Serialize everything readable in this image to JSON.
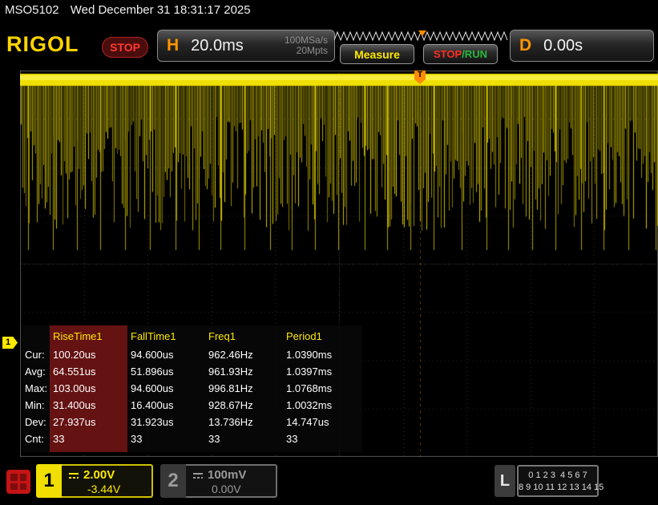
{
  "colors": {
    "ch1_yellow": "#ffe900",
    "accent_orange": "#ff9500",
    "stop_red": "#ff3b30",
    "run_green": "#27b83c",
    "logo_yellow": "#ffd400",
    "measurement_highlight_red": "#641212"
  },
  "status_bar": {
    "model": "MSO5102",
    "datetime": "Wed December 31 18:31:17 2025"
  },
  "header": {
    "logo": "RIGOL",
    "acquisition_state": "STOP",
    "horizontal": {
      "label": "H",
      "timebase": "20.0ms",
      "sample_rate": "100MSa/s",
      "memory_depth": "20Mpts"
    },
    "measure_button": "Measure",
    "stop_run_button": {
      "stop": "STOP",
      "run": "/RUN"
    },
    "delay": {
      "label": "D",
      "value": "0.00s"
    }
  },
  "trigger": {
    "label": "T"
  },
  "measurements": {
    "columns": [
      "RiseTime1",
      "FallTime1",
      "Freq1",
      "Period1"
    ],
    "rows": [
      {
        "label": "Cur:",
        "values": [
          "100.20us",
          "94.600us",
          "962.46Hz",
          "1.0390ms"
        ]
      },
      {
        "label": "Avg:",
        "values": [
          "64.551us",
          "51.896us",
          "961.93Hz",
          "1.0397ms"
        ]
      },
      {
        "label": "Max:",
        "values": [
          "103.00us",
          "94.600us",
          "996.81Hz",
          "1.0768ms"
        ]
      },
      {
        "label": "Min:",
        "values": [
          "31.400us",
          "16.400us",
          "928.67Hz",
          "1.0032ms"
        ]
      },
      {
        "label": "Dev:",
        "values": [
          "27.937us",
          "31.923us",
          "13.736Hz",
          "14.747us"
        ]
      },
      {
        "label": "Cnt:",
        "values": [
          "33",
          "33",
          "33",
          "33"
        ]
      }
    ]
  },
  "channels": {
    "ch1": {
      "number": "1",
      "scale": "2.00V",
      "offset": "-3.44V"
    },
    "ch2": {
      "number": "2",
      "scale": "100mV",
      "offset": "0.00V"
    },
    "digital": {
      "label": "L",
      "row1": "0 1 2 3  4 5 6 7",
      "row2": "8 9 10 11 12 13 14 15"
    }
  },
  "icons": {
    "dc_coupling": "solid-line-over-dashed-line",
    "menu_grid": "2x2-squares",
    "trigger_marker": "orange-T-flag",
    "overview_trigger": "orange-triangle"
  }
}
